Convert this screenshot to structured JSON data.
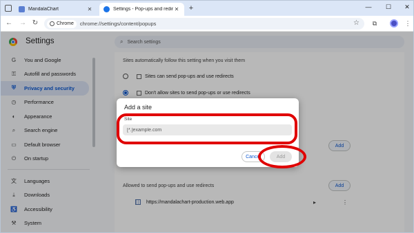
{
  "browser": {
    "tabs": [
      {
        "title": "MandalaChart",
        "active": false
      },
      {
        "title": "Settings - Pop-ups and redirects",
        "active": true
      }
    ],
    "window_controls": {
      "minimize": "—",
      "maximize": "☐",
      "close": "✕"
    },
    "omnibox": {
      "chip": "Chrome",
      "url": "chrome://settings/content/popups"
    }
  },
  "settings": {
    "title": "Settings",
    "search_placeholder": "Search settings",
    "nav": [
      {
        "label": "You and Google",
        "icon": "G"
      },
      {
        "label": "Autofill and passwords",
        "icon": "⚿"
      },
      {
        "label": "Privacy and security",
        "icon": "⛨",
        "selected": true
      },
      {
        "label": "Performance",
        "icon": "◷"
      },
      {
        "label": "Appearance",
        "icon": "◐"
      },
      {
        "label": "Search engine",
        "icon": "⌕"
      },
      {
        "label": "Default browser",
        "icon": "▭"
      },
      {
        "label": "On startup",
        "icon": "⏻"
      },
      {
        "label": "Languages",
        "icon": "文"
      },
      {
        "label": "Downloads",
        "icon": "⤓"
      },
      {
        "label": "Accessibility",
        "icon": "♿"
      },
      {
        "label": "System",
        "icon": "⚒"
      }
    ]
  },
  "content": {
    "description": "Sites automatically follow this setting when you visit them",
    "options": [
      {
        "label": "Sites can send pop-ups and use redirects",
        "selected": false
      },
      {
        "label": "Don't allow sites to send pop-ups or use redirects",
        "selected": true
      }
    ],
    "add_label": "Add",
    "allowed_section": "Allowed to send pop-ups and use redirects",
    "allowed_sites": [
      "https://mandalachart-production.web.app"
    ]
  },
  "dialog": {
    "title": "Add a site",
    "field_label": "Site",
    "placeholder": "[*.]example.com",
    "cancel_label": "Cancel",
    "add_label": "Add"
  },
  "colors": {
    "accent": "#0b57d0",
    "annotation": "#e00000"
  }
}
